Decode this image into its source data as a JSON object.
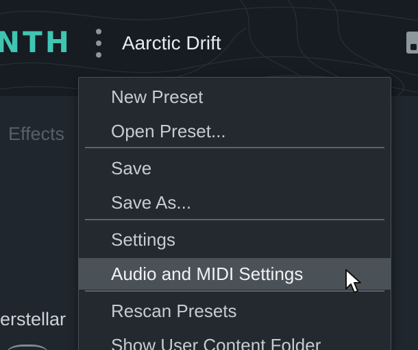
{
  "header": {
    "logo_text": "NTH",
    "preset_name": "Aarctic Drift"
  },
  "tabs": {
    "effects": "Effects"
  },
  "preset_list": [
    "erstellar"
  ],
  "menu": {
    "items": [
      {
        "label": "New Preset"
      },
      {
        "label": "Open Preset..."
      },
      {
        "label": "Save"
      },
      {
        "label": "Save As..."
      },
      {
        "label": "Settings"
      },
      {
        "label": "Audio and MIDI Settings",
        "highlighted": true
      },
      {
        "label": "Rescan Presets"
      },
      {
        "label": "Show User Content Folder"
      }
    ]
  },
  "colors": {
    "accent": "#3fc6b2",
    "menu_background": "#23292f",
    "menu_highlight": "#4a5157",
    "header_background": "#161c22"
  },
  "icons": {
    "more": "kebab-vertical-icon",
    "save": "save-icon",
    "pointer": "mouse-pointer-icon"
  }
}
